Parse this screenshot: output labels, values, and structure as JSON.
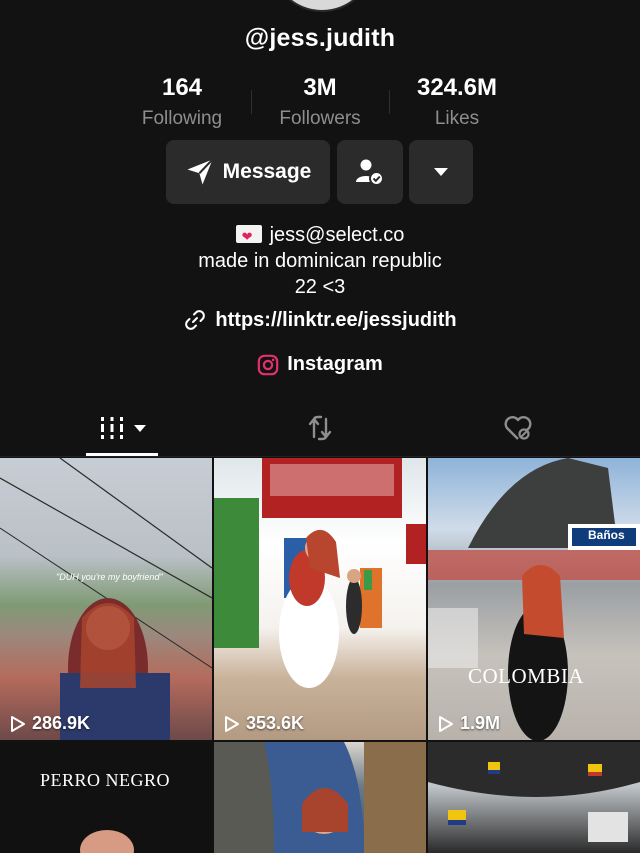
{
  "profile": {
    "username": "@jess.judith",
    "stats": [
      {
        "value": "164",
        "label": "Following"
      },
      {
        "value": "3M",
        "label": "Followers"
      },
      {
        "value": "324.6M",
        "label": "Likes"
      }
    ],
    "message_label": "Message",
    "bio": {
      "email": "jess@select.co",
      "line2": "made in dominican republic",
      "line3": "22 <3"
    },
    "link": "https://linktr.ee/jessjudith",
    "instagram_label": "Instagram"
  },
  "videos": [
    {
      "views": "286.9K",
      "caption": "\"DUH you're my boyfriend\""
    },
    {
      "views": "353.6K"
    },
    {
      "views": "1.9M",
      "overlay": "COLOMBIA",
      "sign": "Baños"
    },
    {
      "overlay": "PERRO NEGRO"
    },
    {},
    {}
  ],
  "colors": {
    "background": "#121212",
    "button": "#2b2b2b",
    "muted_text": "#8e8e8e",
    "instagram_accent": "#e1306c"
  },
  "icons": [
    "send-icon",
    "user-check-icon",
    "caret-down-icon",
    "link-icon",
    "instagram-icon",
    "grid-icon",
    "repost-icon",
    "liked-hidden-icon",
    "play-icon"
  ]
}
